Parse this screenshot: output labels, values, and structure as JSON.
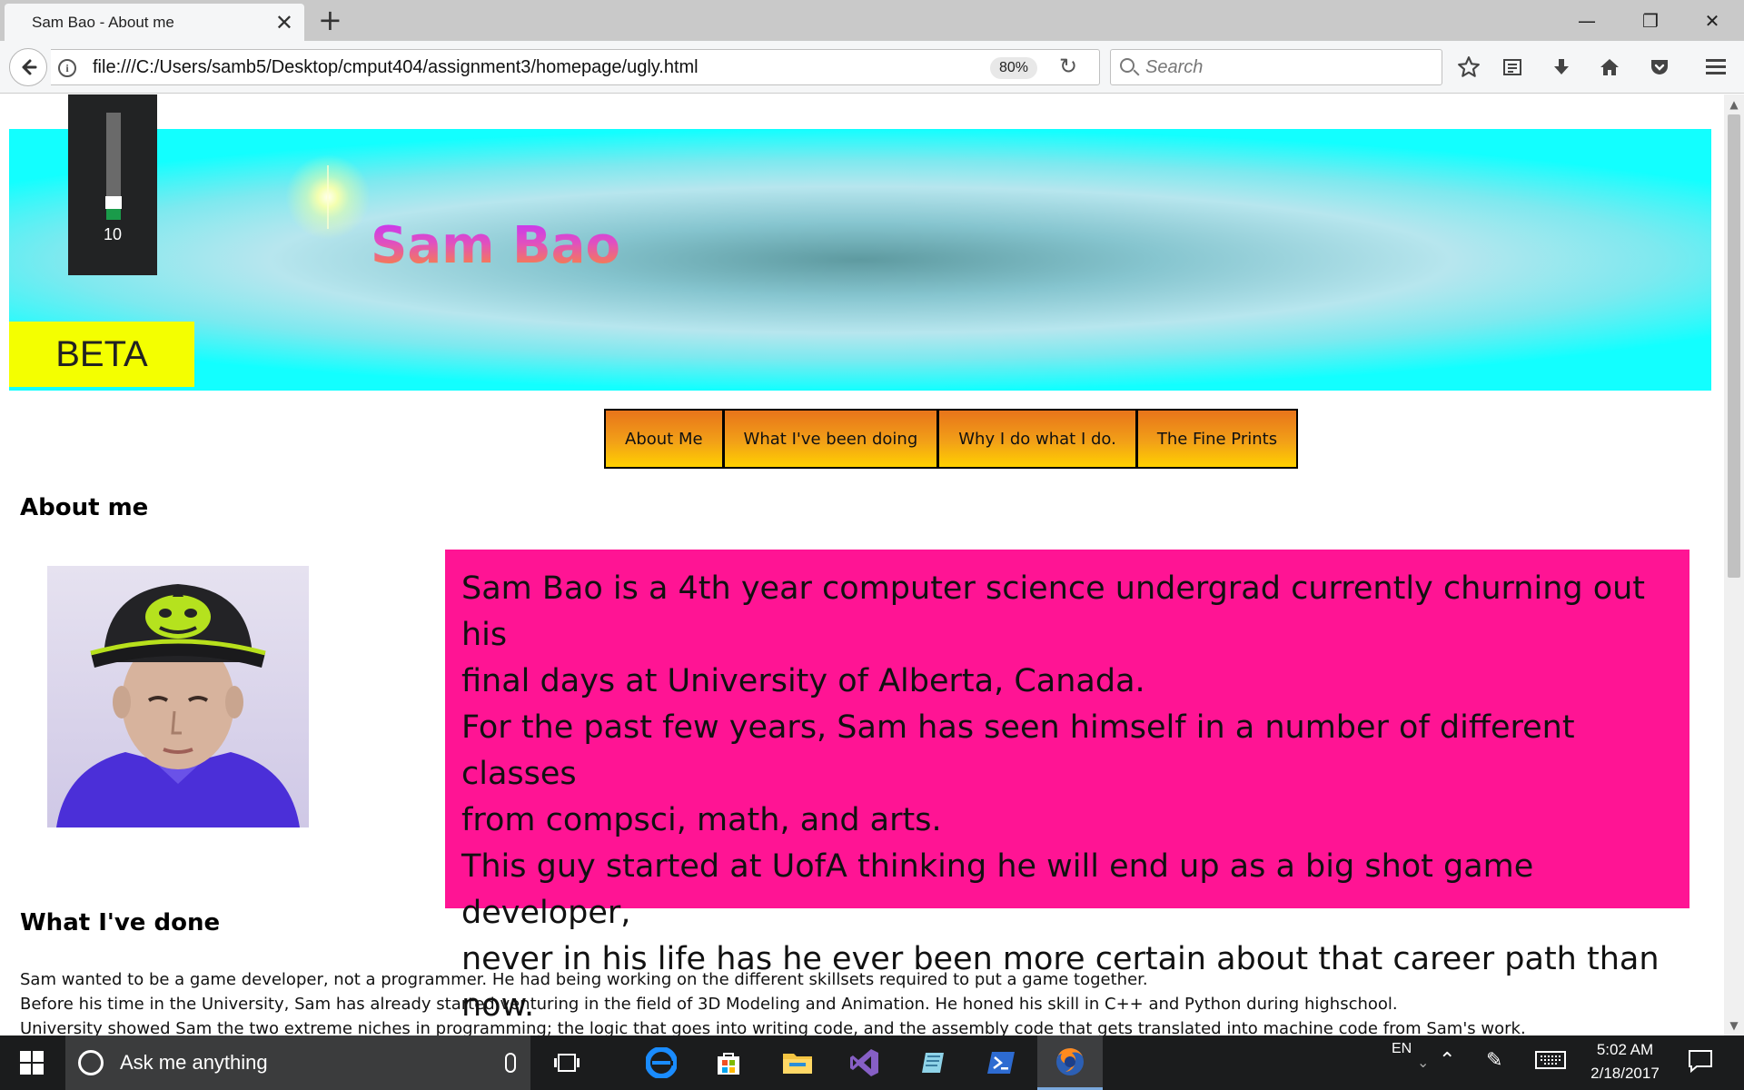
{
  "browser": {
    "tab_title": "Sam Bao - About me",
    "tab_close": "✕",
    "new_tab": "+",
    "minimize": "—",
    "restore": "❐",
    "close": "✕",
    "back": "←",
    "info": "i",
    "url": "file:///C:/Users/samb5/Desktop/cmput404/assignment3/homepage/ugly.html",
    "zoom": "80%",
    "reload": "↻",
    "search_placeholder": "Search",
    "toolbar_icons": [
      "star-icon",
      "reading-list-icon",
      "download-icon",
      "home-icon",
      "pocket-icon",
      "menu-icon"
    ]
  },
  "page": {
    "site_title": "Sam Bao",
    "beta": "BETA",
    "volume": {
      "value": "10",
      "level": 0.1
    },
    "nav": [
      "About Me",
      "What I've been doing",
      "Why I do what I do.",
      "The Fine Prints"
    ],
    "about_heading": "About me",
    "about_lines": [
      "Sam Bao is a 4th year computer science undergrad currently churning out his",
      "final days at University of Alberta, Canada.",
      "For the past few years, Sam has seen himself in a number of different classes",
      "from compsci, math, and arts.",
      "This guy started at UofA thinking he will end up as a big shot game developer,",
      "never in his life has he ever been more certain about that career path than",
      "now."
    ],
    "done_heading": "What I've done",
    "done_lines": [
      "Sam wanted to be a game developer, not a programmer. He had being working on the different skillsets required to put a game together.",
      "Before his time in the University, Sam has already started venturing in the field of 3D Modeling and Animation. He honed his skill in C++ and Python during highschool.",
      "University showed Sam the two extreme niches in programming; the logic that goes into writing code, and the assembly code that gets translated into machine code from Sam's work."
    ]
  },
  "taskbar": {
    "search_placeholder": "Ask me anything",
    "apps": [
      "task-view-icon",
      "edge-icon",
      "store-icon",
      "file-explorer-icon",
      "visual-studio-icon",
      "notepad-icon",
      "powershell-icon",
      "firefox-icon"
    ],
    "language": "EN",
    "time": "5:02 AM",
    "date": "2/18/2017"
  },
  "colors": {
    "about_box": "#ff1494",
    "beta_badge": "#f4ff00",
    "banner_edge": "#12ffff",
    "nav_gradient_top": "#e8741a",
    "nav_gradient_bottom": "#ffd000",
    "volume_fill": "#1a9b4a"
  }
}
